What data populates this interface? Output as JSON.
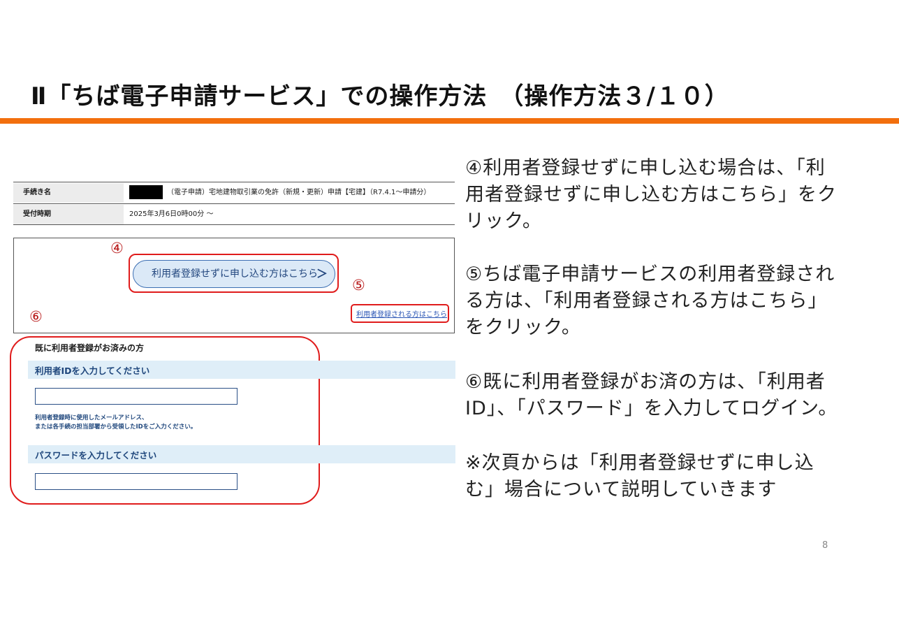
{
  "slide": {
    "title": "Ⅱ「ちば電子申請サービス」での操作方法　（操作方法３/１０）",
    "page_number": "8",
    "accent_color": "#f26f0d"
  },
  "screenshot": {
    "proc_label": "手続き名",
    "proc_value": "（電子申請）宅地建物取引業の免許（新規・更新）申請【宅建】（R7.4.1〜申請分）",
    "period_label": "受付時期",
    "period_value": "2025年3月6日0時00分 〜",
    "circle_4": "④",
    "circle_5": "⑤",
    "circle_6": "⑥",
    "no_register_button": "利用者登録せずに申し込む方はこちら",
    "no_register_chevron": "＞",
    "register_link": "利用者登録される方はこちら",
    "login_heading": "既に利用者登録がお済みの方",
    "userid_label": "利用者IDを入力してください",
    "userid_help_1": "利用者登録時に使用したメールアドレス、",
    "userid_help_2": "または各手続の担当部署から受領したIDをご入力ください。",
    "password_label": "パスワードを入力してください"
  },
  "instructions": {
    "p4_l1": "④利用者登録せずに申し込む場合は、「利",
    "p4_l2": "用者登録せずに申し込む方はこちら」をク",
    "p4_l3": "リック。",
    "p5_l1": "⑤ちば電子申請サービスの利用者登録され",
    "p5_l2": "る方は、「利用者登録される方はこちら」",
    "p5_l3": "をクリック。",
    "p6_l1": "⑥既に利用者登録がお済の方は、「利用者",
    "p6_l2": "ID」、「パスワード」を入力してログイン。",
    "note_l1": "※次頁からは「利用者登録せずに申し込",
    "note_l2": "む」場合について説明していきます"
  }
}
